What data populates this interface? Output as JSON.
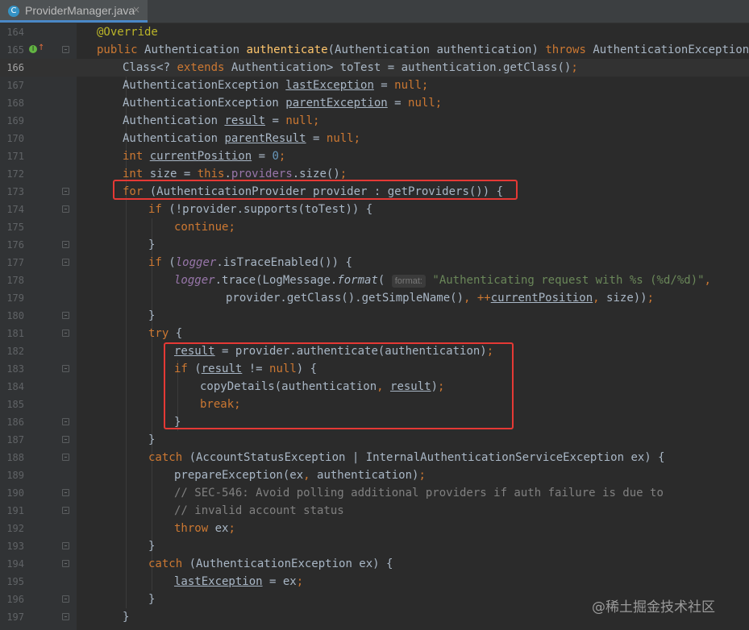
{
  "tab": {
    "label": "ProviderManager.java",
    "icon": "class-c-icon",
    "close": "×"
  },
  "watermark": "@稀土掘金技术社区",
  "lines": [
    {
      "n": "164"
    },
    {
      "n": "165"
    },
    {
      "n": "166"
    },
    {
      "n": "167"
    },
    {
      "n": "168"
    },
    {
      "n": "169"
    },
    {
      "n": "170"
    },
    {
      "n": "171"
    },
    {
      "n": "172"
    },
    {
      "n": "173"
    },
    {
      "n": "174"
    },
    {
      "n": "175"
    },
    {
      "n": "176"
    },
    {
      "n": "177"
    },
    {
      "n": "178"
    },
    {
      "n": "179"
    },
    {
      "n": "180"
    },
    {
      "n": "181"
    },
    {
      "n": "182"
    },
    {
      "n": "183"
    },
    {
      "n": "184"
    },
    {
      "n": "185"
    },
    {
      "n": "186"
    },
    {
      "n": "187"
    },
    {
      "n": "188"
    },
    {
      "n": "189"
    },
    {
      "n": "190"
    },
    {
      "n": "191"
    },
    {
      "n": "192"
    },
    {
      "n": "193"
    },
    {
      "n": "194"
    },
    {
      "n": "195"
    },
    {
      "n": "196"
    },
    {
      "n": "197"
    }
  ],
  "code": {
    "l164": "@Override",
    "l165a": "public ",
    "l165b": "Authentication ",
    "l165c": "authenticate",
    "l165d": "(Authentication authentication) ",
    "l165e": "throws ",
    "l165f": "AuthenticationException {",
    "l166a": "Class<? ",
    "l166b": "extends ",
    "l166c": "Authentication> toTest = authentication.getClass()",
    "l167a": "AuthenticationException ",
    "l167b": "lastException",
    "l167c": " = ",
    "l167d": "null",
    "l168a": "AuthenticationException ",
    "l168b": "parentException",
    "l168c": " = ",
    "l168d": "null",
    "l169a": "Authentication ",
    "l169b": "result",
    "l169c": " = ",
    "l169d": "null",
    "l170a": "Authentication ",
    "l170b": "parentResult",
    "l170c": " = ",
    "l170d": "null",
    "l171a": "int ",
    "l171b": "currentPosition",
    "l171c": " = ",
    "l171d": "0",
    "l172a": "int ",
    "l172b": "size = ",
    "l172c": "this",
    "l172d": ".",
    "l172e": "providers",
    "l172f": ".size()",
    "l173a": "for ",
    "l173b": "(AuthenticationProvider provider : getProviders()) {",
    "l174a": "if ",
    "l174b": "(!provider.supports(toTest)) {",
    "l175": "continue",
    "l176": "}",
    "l177a": "if ",
    "l177b": "(",
    "l177c": "logger",
    "l177d": ".isTraceEnabled()) {",
    "l178a": "logger",
    "l178b": ".trace(LogMessage.",
    "l178c": "format",
    "l178d": "( ",
    "l178hint": "format:",
    "l178e": " \"Authenticating request with %s (%d/%d)\"",
    "l179a": "provider.getClass().getSimpleName()",
    "l179b": ", ++",
    "l179c": "currentPosition",
    "l179d": ", ",
    "l179e": "size))",
    "l180": "}",
    "l181a": "try ",
    "l181b": "{",
    "l182a": "result",
    "l182b": " = provider.authenticate(authentication)",
    "l183a": "if ",
    "l183b": "(",
    "l183c": "result",
    "l183d": " != ",
    "l183e": "null",
    "l183f": ") {",
    "l184a": "copyDetails(authentication",
    "l184b": ", ",
    "l184c": "result",
    "l184d": ")",
    "l185": "break",
    "l186": "}",
    "l187": "}",
    "l188a": "catch ",
    "l188b": "(AccountStatusException | InternalAuthenticationServiceException ex) {",
    "l189a": "prepareException(ex",
    "l189b": ", ",
    "l189c": "authentication)",
    "l190": "// SEC-546: Avoid polling additional providers if auth failure is due to",
    "l191": "// invalid account status",
    "l192a": "throw ",
    "l192b": "ex",
    "l193": "}",
    "l194a": "catch ",
    "l194b": "(AuthenticationException ex) {",
    "l195a": "lastException",
    "l195b": " = ex",
    "l196": "}",
    "l197": "}",
    "semi": ";",
    "comma": ","
  }
}
